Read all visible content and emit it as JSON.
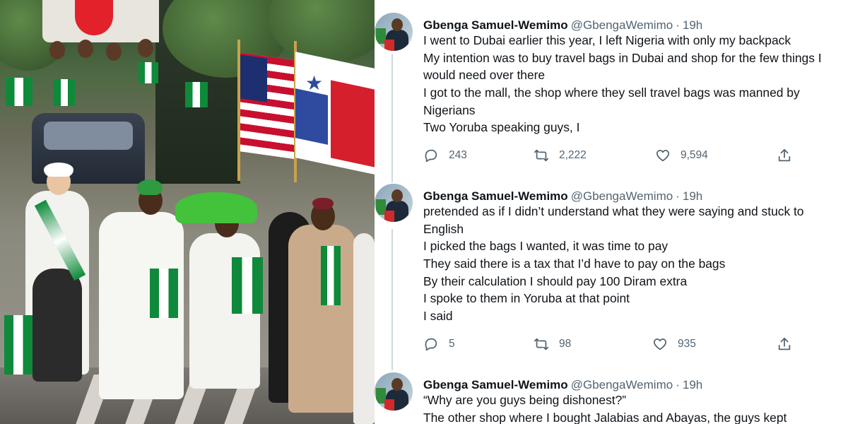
{
  "tweets": [
    {
      "author": {
        "name": "Gbenga Samuel-Wemimo",
        "handle": "@GbengaWemimo",
        "time": "19h"
      },
      "lines": [
        "I went to Dubai earlier this year, I left Nigeria with only my backpack",
        "My intention was to buy travel bags in Dubai and shop for the few things I",
        "would need over there",
        "I got to the mall, the shop where they sell travel bags was manned by",
        "Nigerians",
        "Two Yoruba speaking guys, I"
      ],
      "replies": "243",
      "retweets": "2,222",
      "likes": "9,594"
    },
    {
      "author": {
        "name": "Gbenga Samuel-Wemimo",
        "handle": "@GbengaWemimo",
        "time": "19h"
      },
      "lines": [
        "pretended as if I didn’t understand what they were saying and stuck to",
        "English",
        "I picked the bags I wanted, it was time to pay",
        "They said there is a tax that I’d have to pay on the bags",
        "By their calculation I should pay 100 Diram extra",
        "I spoke to them in Yoruba at that point",
        "I said"
      ],
      "replies": "5",
      "retweets": "98",
      "likes": "935"
    },
    {
      "author": {
        "name": "Gbenga Samuel-Wemimo",
        "handle": "@GbengaWemimo",
        "time": "19h"
      },
      "lines": [
        "“Why are you guys being dishonest?”",
        "The other shop where I bought Jalabias and Abayas, the guys kept"
      ]
    }
  ],
  "icons": {
    "reply": "reply-icon",
    "retweet": "retweet-icon",
    "like": "heart-icon",
    "share": "share-icon"
  },
  "colors": {
    "text": "#0f1419",
    "muted": "#536471",
    "line": "#cfd9de"
  }
}
